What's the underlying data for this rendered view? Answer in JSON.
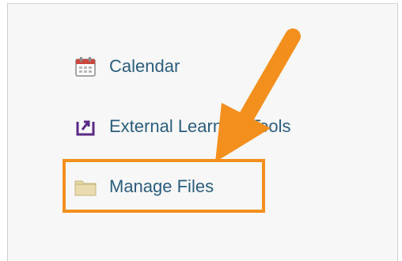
{
  "menu": {
    "items": [
      {
        "label": "Calendar",
        "icon": "calendar-icon"
      },
      {
        "label": "External Learning Tools",
        "icon": "external-tool-icon"
      },
      {
        "label": "Manage Files",
        "icon": "folder-icon"
      }
    ]
  },
  "annotation": {
    "highlight_color": "#f3901d",
    "arrow_color": "#f3901d",
    "highlighted_item": "Manage Files"
  },
  "colors": {
    "link": "#2b5d7d",
    "background": "#f7f7f7"
  }
}
